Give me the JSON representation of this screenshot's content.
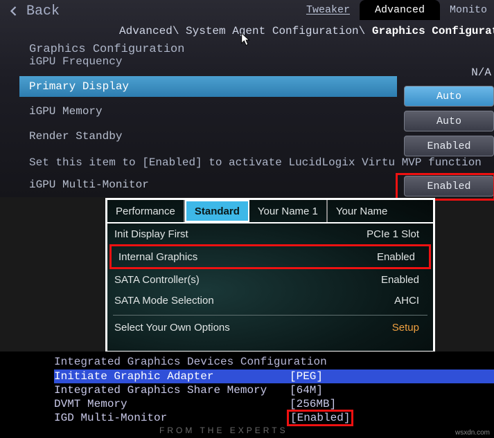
{
  "panel1": {
    "back_label": "Back",
    "top_tabs": {
      "tweaker": "Tweaker",
      "advanced": "Advanced",
      "monitor": "Monito"
    },
    "breadcrumb_prefix": "Advanced\\ System Agent Configuration\\",
    "breadcrumb_current": "Graphics Configurati",
    "section_title": "Graphics Configuration",
    "igpu_freq_label": "iGPU Frequency",
    "na_label": "N/A",
    "rows": {
      "primary_display": {
        "label": "Primary Display",
        "value": "Auto"
      },
      "igpu_memory": {
        "label": "iGPU Memory",
        "value": "Auto"
      },
      "render_standby": {
        "label": "Render Standby",
        "value": "Enabled"
      },
      "multi_monitor": {
        "label": "iGPU Multi-Monitor",
        "value": "Enabled"
      }
    },
    "help_text": "Set this item to [Enabled] to activate LucidLogix Virtu MVP function"
  },
  "panel2": {
    "tabs": [
      "Performance",
      "Standard",
      "Your Name 1",
      "Your Name"
    ],
    "rows": {
      "init_display": {
        "label": "Init Display First",
        "value": "PCIe 1 Slot"
      },
      "internal_graphics": {
        "label": "Internal Graphics",
        "value": "Enabled"
      },
      "sata_controller": {
        "label": "SATA Controller(s)",
        "value": "Enabled"
      },
      "sata_mode": {
        "label": "SATA Mode Selection",
        "value": "AHCI"
      },
      "select_own": {
        "label": "Select Your Own Options",
        "value": "Setup"
      }
    }
  },
  "panel3": {
    "title": "Integrated Graphics Devices Configuration",
    "rows": {
      "initiate": {
        "label": "Initiate Graphic Adapter",
        "value": "[PEG]"
      },
      "share_mem": {
        "label": "Integrated Graphics Share Memory",
        "value": "[64M]"
      },
      "dvmt": {
        "label": "DVMT Memory",
        "value": "[256MB]"
      },
      "igd_multi": {
        "label": "IGD Multi-Monitor",
        "value": "[Enabled]"
      }
    },
    "footer": "FROM THE EXPERTS",
    "watermark": "wsxdn.com"
  }
}
